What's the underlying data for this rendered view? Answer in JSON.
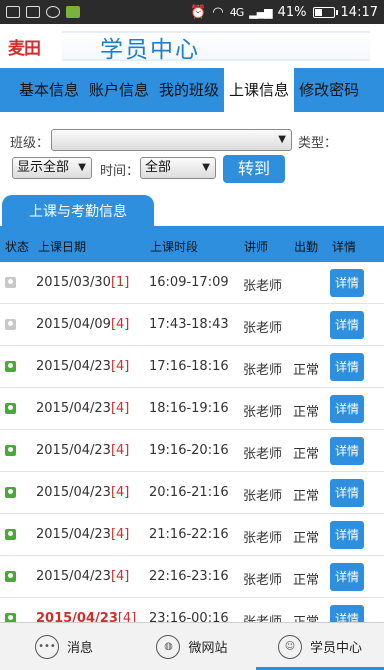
{
  "status_bar": {
    "network": "4G",
    "battery_percent": "41%",
    "battery_level": 0.41,
    "time": "14:17"
  },
  "header": {
    "logo_text": "麦田",
    "title": "学员中心"
  },
  "tabs": [
    {
      "label": "基本信息",
      "active": false
    },
    {
      "label": "账户信息",
      "active": false
    },
    {
      "label": "我的班级",
      "active": false
    },
    {
      "label": "上课信息",
      "active": true
    },
    {
      "label": "修改密码",
      "active": false
    }
  ],
  "filter": {
    "class_label": "班级：",
    "class_value": "",
    "type_label": "类型：",
    "show_value": "显示全部",
    "time_label": "时间：",
    "time_value": "全部",
    "goto_label": "转到"
  },
  "section_tab": "上课与考勤信息",
  "table": {
    "headers": [
      "状态",
      "上课日期",
      "上课时段",
      "讲师",
      "出勤",
      "详情"
    ],
    "rows": [
      {
        "status": "gray",
        "date": "2015/03/30",
        "count": "[1]",
        "time": "16:09-17:09",
        "teacher": "张老师",
        "attendance": "",
        "detail": "详情",
        "highlight": false
      },
      {
        "status": "gray",
        "date": "2015/04/09",
        "count": "[4]",
        "time": "17:43-18:43",
        "teacher": "张老师",
        "attendance": "",
        "detail": "详情",
        "highlight": false
      },
      {
        "status": "green",
        "date": "2015/04/23",
        "count": "[4]",
        "time": "17:16-18:16",
        "teacher": "张老师",
        "attendance": "正常",
        "detail": "详情",
        "highlight": false
      },
      {
        "status": "green",
        "date": "2015/04/23",
        "count": "[4]",
        "time": "18:16-19:16",
        "teacher": "张老师",
        "attendance": "正常",
        "detail": "详情",
        "highlight": false
      },
      {
        "status": "green",
        "date": "2015/04/23",
        "count": "[4]",
        "time": "19:16-20:16",
        "teacher": "张老师",
        "attendance": "正常",
        "detail": "详情",
        "highlight": false
      },
      {
        "status": "green",
        "date": "2015/04/23",
        "count": "[4]",
        "time": "20:16-21:16",
        "teacher": "张老师",
        "attendance": "正常",
        "detail": "详情",
        "highlight": false
      },
      {
        "status": "green",
        "date": "2015/04/23",
        "count": "[4]",
        "time": "21:16-22:16",
        "teacher": "张老师",
        "attendance": "正常",
        "detail": "详情",
        "highlight": false
      },
      {
        "status": "green",
        "date": "2015/04/23",
        "count": "[4]",
        "time": "22:16-23:16",
        "teacher": "张老师",
        "attendance": "正常",
        "detail": "详情",
        "highlight": false
      },
      {
        "status": "green",
        "date": "2015/04/23",
        "count": "[4]",
        "time": "23:16-00:16",
        "teacher": "张老师",
        "attendance": "正常",
        "detail": "详情",
        "highlight": true
      }
    ]
  },
  "bottom_nav": [
    {
      "label": "消息",
      "icon": "message-icon",
      "active": false
    },
    {
      "label": "微网站",
      "icon": "globe-icon",
      "active": false
    },
    {
      "label": "学员中心",
      "icon": "user-icon",
      "active": true
    }
  ]
}
